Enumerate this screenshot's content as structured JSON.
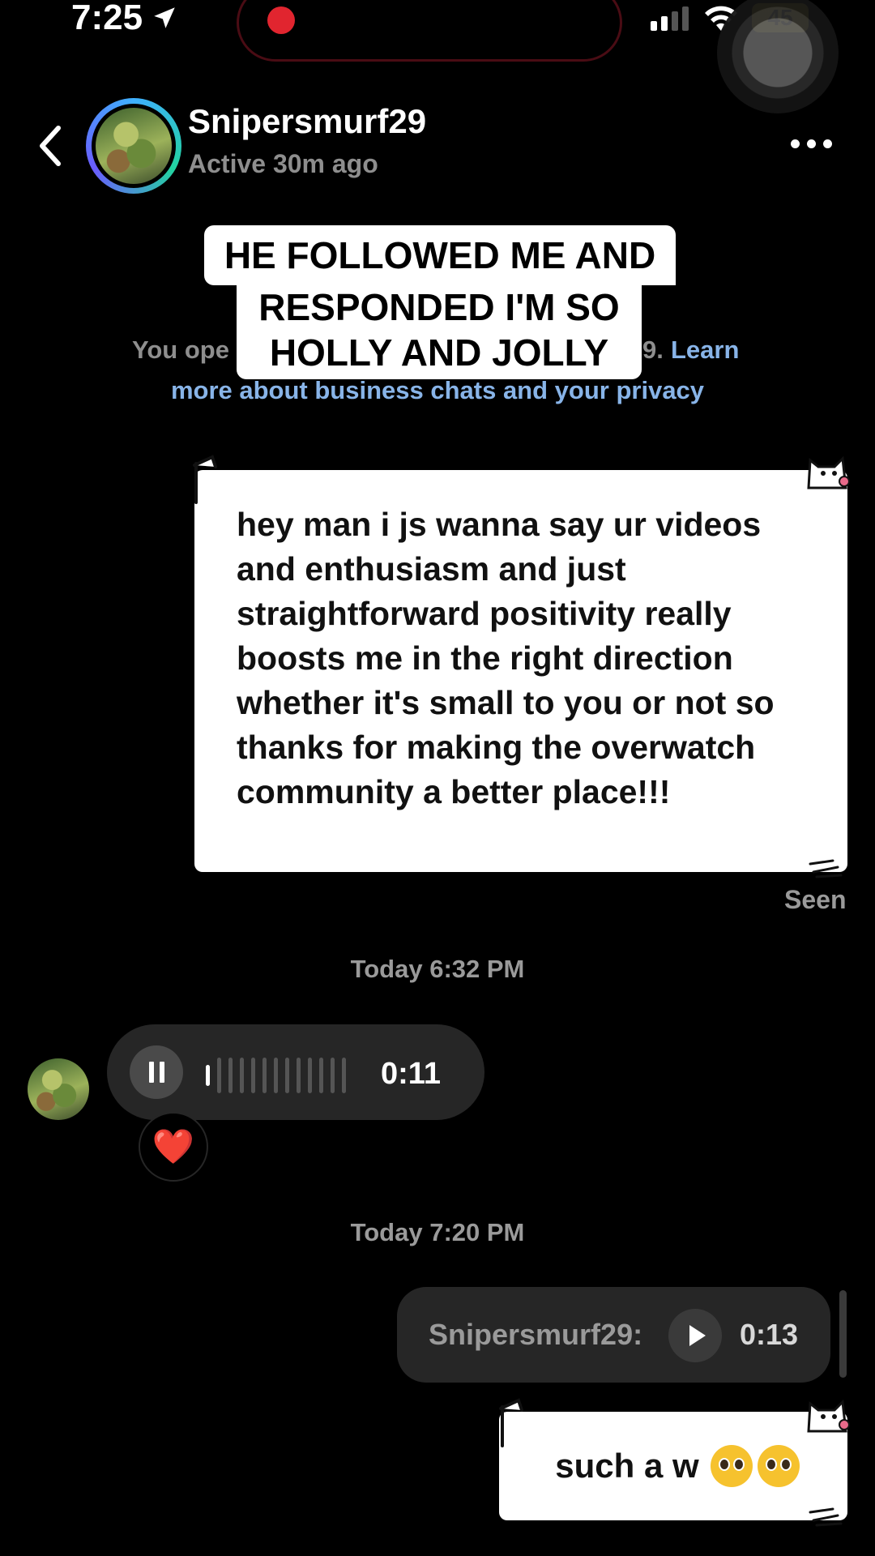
{
  "status_bar": {
    "time": "7:25",
    "battery": "45"
  },
  "header": {
    "username": "Snipersmurf29",
    "status": "Active 30m ago"
  },
  "overlay_caption": {
    "line1": "HE FOLLOWED ME AND",
    "line2": "RESPONDED I'M SO",
    "line3": "HOLLY AND JOLLY"
  },
  "privacy_notice": {
    "visible_start": "You ope",
    "visible_end": "9.",
    "link_part1": "Learn",
    "link_part2": "more about business chats and your privacy"
  },
  "messages": {
    "sent_text": "hey man i js wanna say ur videos and enthusiasm and just straightforward positivity really boosts me in the right direction whether it's small to you or not so thanks for making the overwatch community a better place!!!",
    "seen_label": "Seen",
    "timestamp_1": "Today 6:32 PM",
    "voice_duration": "0:11",
    "reaction": "❤️",
    "timestamp_2": "Today 7:20 PM",
    "shared_audio_sender": "Snipersmurf29:",
    "shared_audio_duration": "0:13",
    "reply_text": "such a w"
  },
  "colors": {
    "background": "#000000",
    "bubble_dark": "#262626",
    "link_blue": "#88b4e8",
    "muted_text": "#8e8e8e",
    "battery_yellow": "#e4c83a",
    "record_red": "#e1252f"
  },
  "icons": [
    "location-arrow-icon",
    "record-dot-icon",
    "signal-icon",
    "wifi-icon",
    "back-chevron-icon",
    "more-options-icon",
    "pause-icon",
    "waveform-icon",
    "heart-icon",
    "play-icon",
    "pleading-face-emoji-icon"
  ]
}
